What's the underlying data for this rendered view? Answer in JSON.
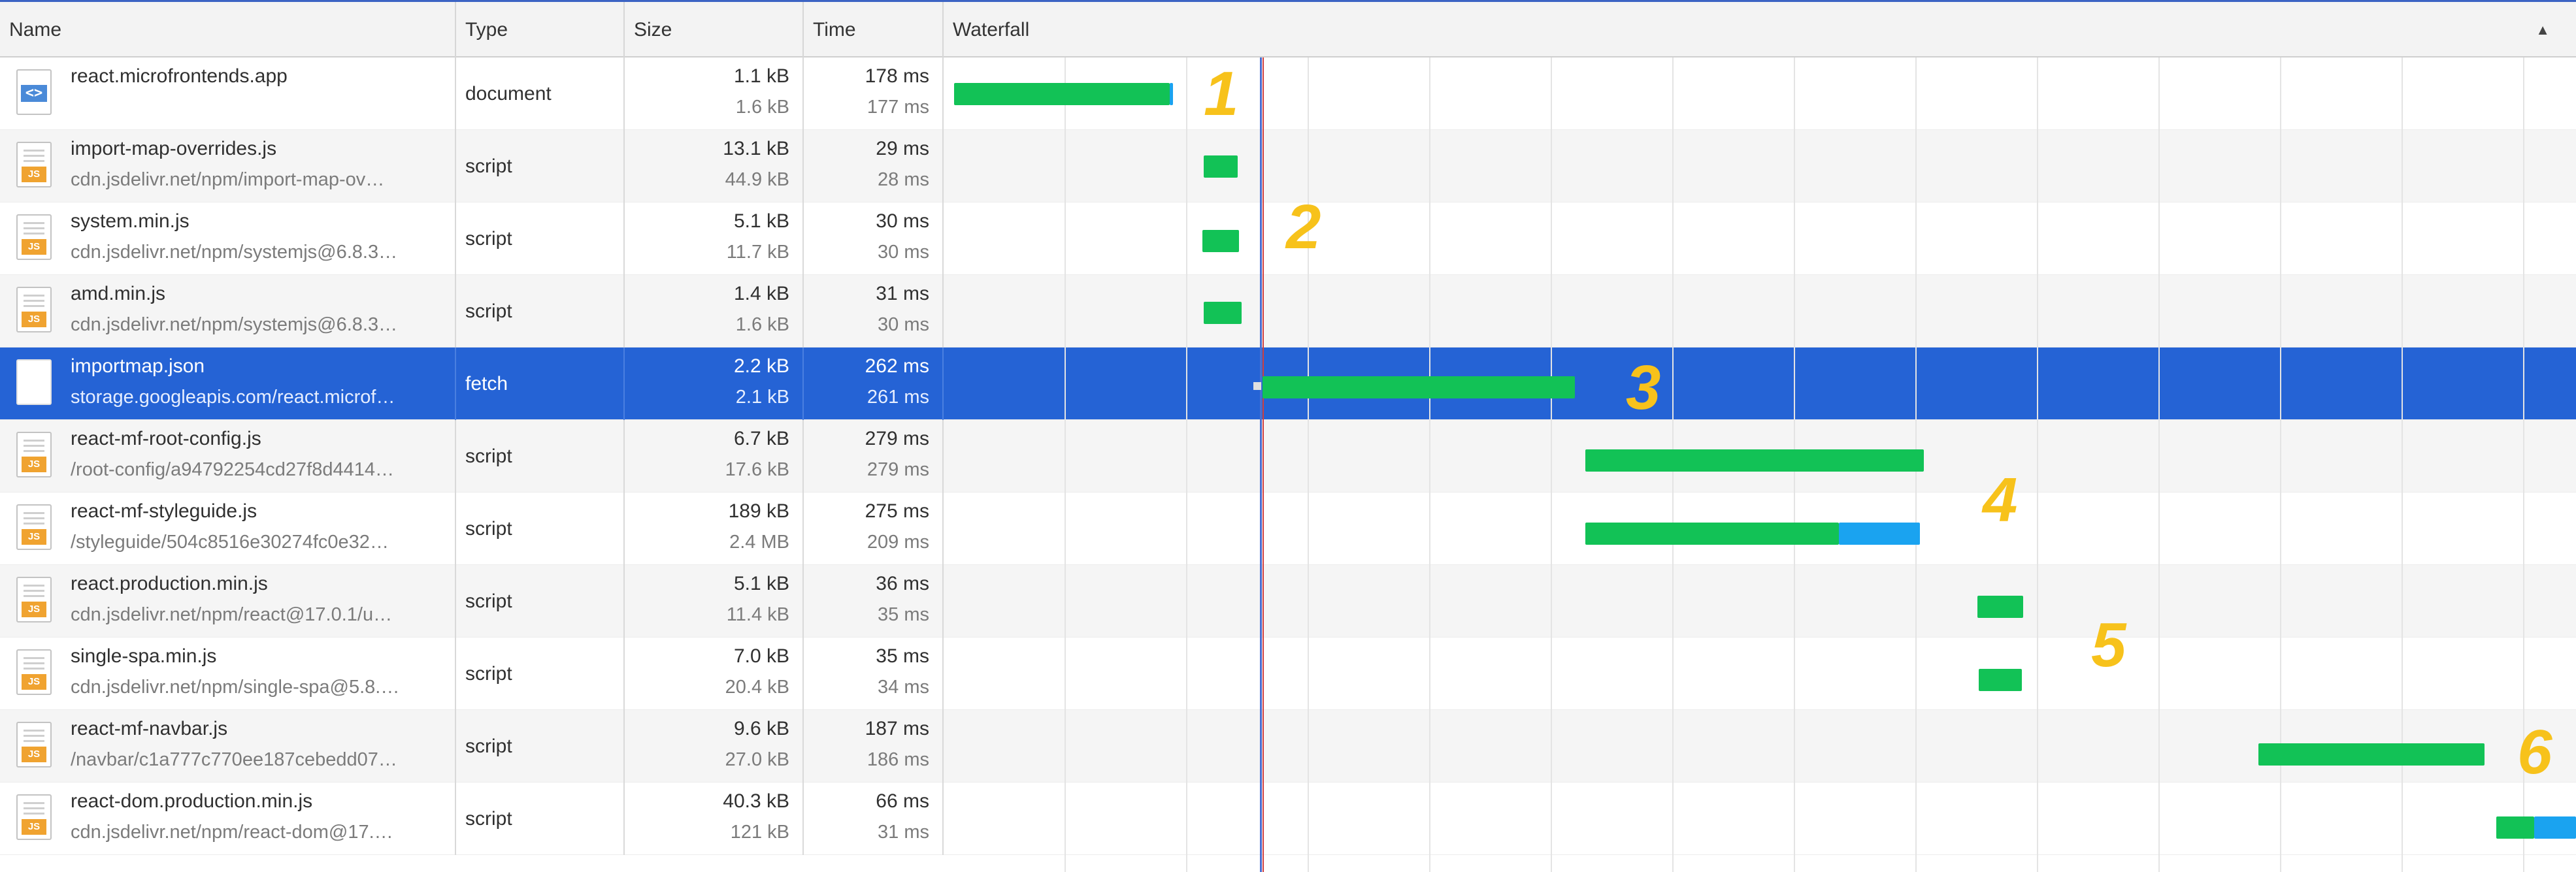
{
  "columns": {
    "name": "Name",
    "type": "Type",
    "size": "Size",
    "time": "Time",
    "waterfall": "Waterfall",
    "sort_indicator": "▲"
  },
  "rows": [
    {
      "name": "react.microfrontends.app",
      "subtitle": "",
      "type": "document",
      "size": "1.1 kB",
      "resource_size": "1.6 kB",
      "time": "178 ms",
      "latency": "177 ms",
      "icon": "html-document-icon"
    },
    {
      "name": "import-map-overrides.js",
      "subtitle": "cdn.jsdelivr.net/npm/import-map-ov…",
      "type": "script",
      "size": "13.1 kB",
      "resource_size": "44.9 kB",
      "time": "29 ms",
      "latency": "28 ms",
      "icon": "js-file-icon"
    },
    {
      "name": "system.min.js",
      "subtitle": "cdn.jsdelivr.net/npm/systemjs@6.8.3…",
      "type": "script",
      "size": "5.1 kB",
      "resource_size": "11.7 kB",
      "time": "30 ms",
      "latency": "30 ms",
      "icon": "js-file-icon"
    },
    {
      "name": "amd.min.js",
      "subtitle": "cdn.jsdelivr.net/npm/systemjs@6.8.3…",
      "type": "script",
      "size": "1.4 kB",
      "resource_size": "1.6 kB",
      "time": "31 ms",
      "latency": "30 ms",
      "icon": "js-file-icon"
    },
    {
      "name": "importmap.json",
      "subtitle": "storage.googleapis.com/react.microf…",
      "type": "fetch",
      "size": "2.2 kB",
      "resource_size": "2.1 kB",
      "time": "262 ms",
      "latency": "261 ms",
      "icon": "blank-file-icon"
    },
    {
      "name": "react-mf-root-config.js",
      "subtitle": "/root-config/a94792254cd27f8d4414…",
      "type": "script",
      "size": "6.7 kB",
      "resource_size": "17.6 kB",
      "time": "279 ms",
      "latency": "279 ms",
      "icon": "js-file-icon"
    },
    {
      "name": "react-mf-styleguide.js",
      "subtitle": "/styleguide/504c8516e30274fc0e32…",
      "type": "script",
      "size": "189 kB",
      "resource_size": "2.4 MB",
      "time": "275 ms",
      "latency": "209 ms",
      "icon": "js-file-icon"
    },
    {
      "name": "react.production.min.js",
      "subtitle": "cdn.jsdelivr.net/npm/react@17.0.1/u…",
      "type": "script",
      "size": "5.1 kB",
      "resource_size": "11.4 kB",
      "time": "36 ms",
      "latency": "35 ms",
      "icon": "js-file-icon"
    },
    {
      "name": "single-spa.min.js",
      "subtitle": "cdn.jsdelivr.net/npm/single-spa@5.8.…",
      "type": "script",
      "size": "7.0 kB",
      "resource_size": "20.4 kB",
      "time": "35 ms",
      "latency": "34 ms",
      "icon": "js-file-icon"
    },
    {
      "name": "react-mf-navbar.js",
      "subtitle": "/navbar/c1a777c770ee187cebedd07…",
      "type": "script",
      "size": "9.6 kB",
      "resource_size": "27.0 kB",
      "time": "187 ms",
      "latency": "186 ms",
      "icon": "js-file-icon"
    },
    {
      "name": "react-dom.production.min.js",
      "subtitle": "cdn.jsdelivr.net/npm/react-dom@17.…",
      "type": "script",
      "size": "40.3 kB",
      "resource_size": "121 kB",
      "time": "66 ms",
      "latency": "31 ms",
      "icon": "js-file-icon"
    }
  ],
  "selected_row_index": 4,
  "js_icon_text": "JS",
  "doc_icon_text": "<>",
  "annotations": [
    "1",
    "2",
    "3",
    "4",
    "5",
    "6"
  ],
  "colors": {
    "selected_row": "#2563d5",
    "waiting_bar": "#12c256",
    "download_bar": "#1aa3f0",
    "annotation": "#f7c21b",
    "dom_content_loaded_line": "#4a6fd1"
  }
}
